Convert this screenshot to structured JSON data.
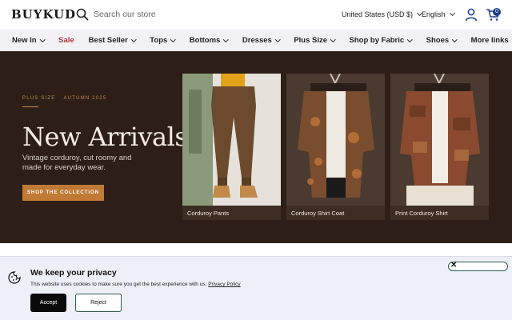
{
  "header": {
    "logo": "BUYKUD",
    "search_placeholder": "Search our store",
    "currency": "United States (USD $)",
    "language": "English",
    "cart_count": "0"
  },
  "nav": {
    "items": [
      {
        "label": "New In"
      },
      {
        "label": "Sale"
      },
      {
        "label": "Best Seller"
      },
      {
        "label": "Tops"
      },
      {
        "label": "Bottoms"
      },
      {
        "label": "Dresses"
      },
      {
        "label": "Plus Size"
      },
      {
        "label": "Shop by Fabric"
      },
      {
        "label": "Shoes"
      },
      {
        "label": "More links"
      }
    ]
  },
  "hero": {
    "eyebrow_left": "PLUS SIZE",
    "eyebrow_right": "AUTUMN 2025",
    "title": "New Arrivals",
    "subtitle": "Vintage corduroy, cut roomy and made for everyday wear.",
    "cta": "SHOP THE COLLECTION",
    "cards": [
      {
        "label": "Corduroy Pants"
      },
      {
        "label": "Corduroy Shirt Coat"
      },
      {
        "label": "Print Corduroy Shirt"
      }
    ]
  },
  "cookie": {
    "title": "We keep your privacy",
    "text": "This website uses cookies to make sure you get the best experience with us.",
    "link": "Privacy Policy",
    "accept": "Accept",
    "reject": "Reject"
  },
  "colors": {
    "hero_bg": "#2d1f18",
    "accent": "#c17a36",
    "nav_bg": "#f2f1f6",
    "sale": "#b33a3a",
    "cookie_bg": "#eef0f7"
  }
}
